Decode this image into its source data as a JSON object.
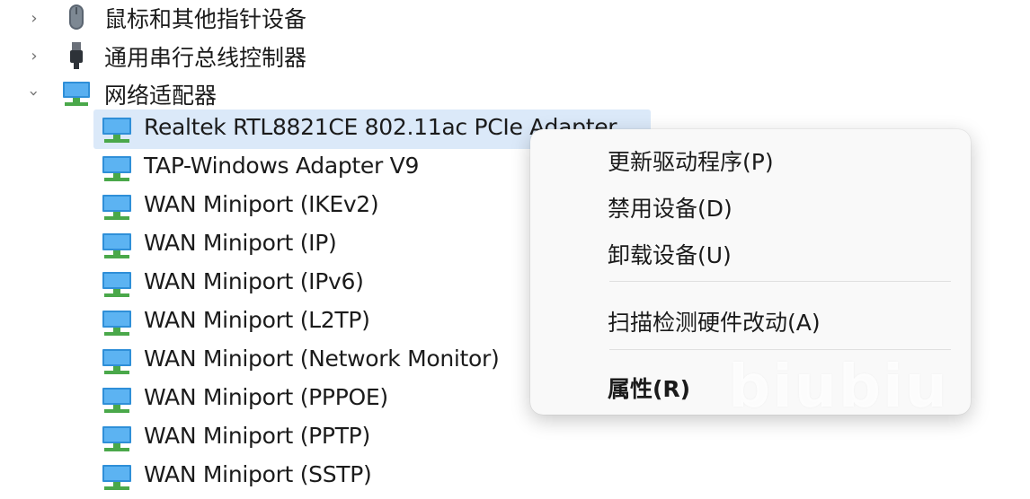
{
  "tree": {
    "categories": [
      {
        "label": "鼠标和其他指针设备",
        "icon": "mouse-icon",
        "expanded": false
      },
      {
        "label": "通用串行总线控制器",
        "icon": "usb-icon",
        "expanded": false
      },
      {
        "label": "网络适配器",
        "icon": "network-adapter-icon",
        "expanded": true
      }
    ],
    "devices": [
      {
        "label": "Realtek RTL8821CE 802.11ac PCIe Adapter",
        "selected": true
      },
      {
        "label": "TAP-Windows Adapter V9"
      },
      {
        "label": "WAN Miniport (IKEv2)"
      },
      {
        "label": "WAN Miniport (IP)"
      },
      {
        "label": "WAN Miniport (IPv6)"
      },
      {
        "label": "WAN Miniport (L2TP)"
      },
      {
        "label": "WAN Miniport (Network Monitor)"
      },
      {
        "label": "WAN Miniport (PPPOE)"
      },
      {
        "label": "WAN Miniport (PPTP)"
      },
      {
        "label": "WAN Miniport (SSTP)"
      }
    ],
    "icon_colors": {
      "monitor": "#2f8fd8",
      "stand": "#4aa84a"
    }
  },
  "context_menu": {
    "items": [
      {
        "label": "更新驱动程序(P)"
      },
      {
        "label": "禁用设备(D)"
      },
      {
        "label": "卸载设备(U)"
      },
      {
        "label": "扫描检测硬件改动(A)"
      },
      {
        "label": "属性(R)",
        "bold": true
      }
    ],
    "watermark": "biubiu"
  },
  "colors": {
    "selection": "#dbe9f9",
    "menu_bg": "#f9f9f9"
  }
}
